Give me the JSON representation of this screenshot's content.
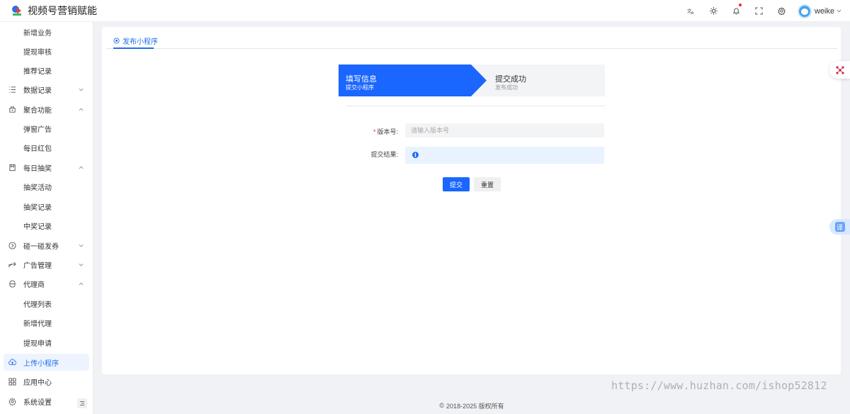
{
  "app": {
    "title": "视频号营销赋能"
  },
  "header": {
    "icons": [
      "translate-icon",
      "sun-icon",
      "bell-icon",
      "fullscreen-icon",
      "gear-icon"
    ],
    "user": {
      "name": "weike"
    }
  },
  "sidebar": {
    "items": [
      {
        "label": "新增业务",
        "type": "sub"
      },
      {
        "label": "提现审核",
        "type": "sub"
      },
      {
        "label": "推荐记录",
        "type": "sub"
      },
      {
        "label": "数据记录",
        "type": "group",
        "icon": "list-icon",
        "expanded": false
      },
      {
        "label": "聚合功能",
        "type": "group",
        "icon": "aggregate-icon",
        "expanded": true
      },
      {
        "label": "弹窗广告",
        "type": "sub"
      },
      {
        "label": "每日红包",
        "type": "sub"
      },
      {
        "label": "每日抽奖",
        "type": "group",
        "icon": "lottery-icon",
        "expanded": true
      },
      {
        "label": "抽奖活动",
        "type": "sub"
      },
      {
        "label": "抽奖记录",
        "type": "sub"
      },
      {
        "label": "中奖记录",
        "type": "sub"
      },
      {
        "label": "碰一碰发券",
        "type": "group",
        "icon": "coupon-icon",
        "expanded": false
      },
      {
        "label": "广告管理",
        "type": "group",
        "icon": "ad-icon",
        "expanded": false
      },
      {
        "label": "代理商",
        "type": "group",
        "icon": "agent-icon",
        "expanded": true
      },
      {
        "label": "代理列表",
        "type": "sub"
      },
      {
        "label": "新增代理",
        "type": "sub"
      },
      {
        "label": "提现申请",
        "type": "sub"
      },
      {
        "label": "上传小程序",
        "type": "leaf",
        "icon": "cloud-upload-icon",
        "active": true
      },
      {
        "label": "应用中心",
        "type": "leaf",
        "icon": "grid-icon"
      },
      {
        "label": "系统设置",
        "type": "leaf",
        "icon": "settings-icon"
      }
    ]
  },
  "main": {
    "tab": {
      "label": "发布小程序"
    },
    "steps": [
      {
        "title": "填写信息",
        "subtitle": "提交小程序",
        "active": true
      },
      {
        "title": "提交成功",
        "subtitle": "发布成功",
        "active": false
      }
    ],
    "form": {
      "version_label": "版本号:",
      "version_placeholder": "请输入版本号",
      "version_value": "",
      "result_label": "提交结果:",
      "result_value": ""
    },
    "buttons": {
      "submit": "提交",
      "reset": "重置"
    }
  },
  "footer": {
    "copyright": "2018-2025 版权所有"
  },
  "widgets": {
    "translate_label": "译"
  },
  "watermark": "https://www.huzhan.com/ishop52812",
  "colors": {
    "primary": "#1a66ff",
    "active_bg": "#eef4ff"
  }
}
